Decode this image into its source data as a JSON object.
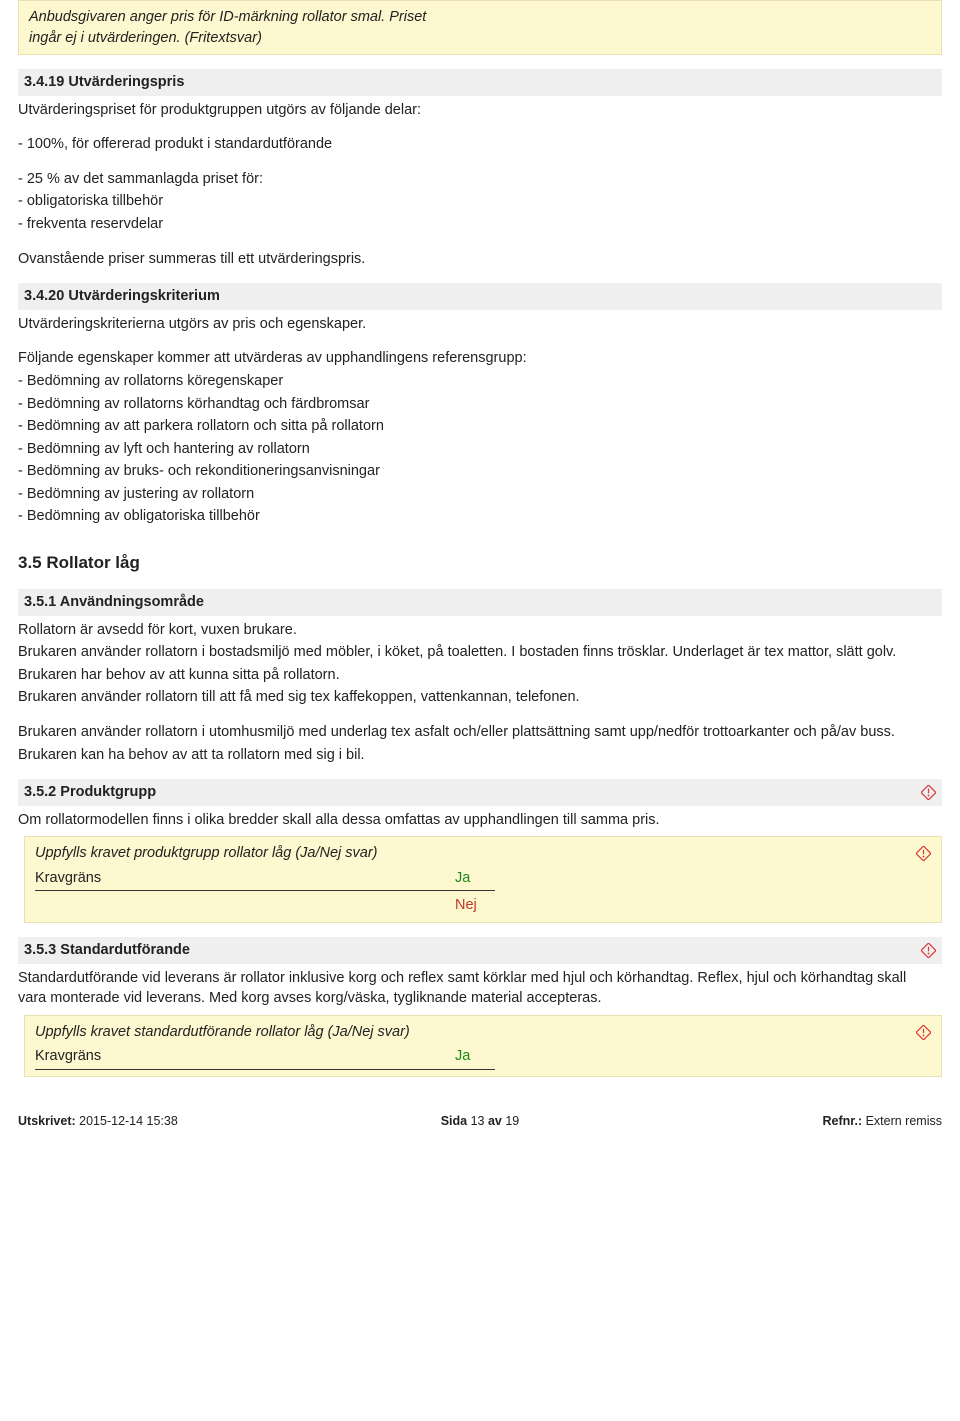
{
  "intro": {
    "line1": "Anbudsgivaren anger pris för ID-märkning rollator smal. Priset",
    "line2": "ingår ej i utvärderingen. (Fritextsvar)"
  },
  "s3419": {
    "title": "3.4.19 Utvärderingspris",
    "intro": "Utvärderingspriset för produktgruppen utgörs av följande delar:",
    "b1": "- 100%, för offererad produkt i standardutförande",
    "b2": "- 25 % av det sammanlagda priset för:",
    "b3": "- obligatoriska tillbehör",
    "b4": "- frekventa reservdelar",
    "outro": "Ovanstående priser summeras till ett utvärderingspris."
  },
  "s3420": {
    "title": "3.4.20 Utvärderingskriterium",
    "intro": "Utvärderingskriterierna utgörs av pris och egenskaper.",
    "list_intro": "Följande egenskaper kommer att utvärderas av upphandlingens referensgrupp:",
    "i1": "- Bedömning av rollatorns köregenskaper",
    "i2": "- Bedömning av rollatorns körhandtag och färdbromsar",
    "i3": "- Bedömning av att parkera rollatorn och sitta på rollatorn",
    "i4": "- Bedömning av lyft och hantering av rollatorn",
    "i5": "- Bedömning av bruks- och rekonditioneringsanvisningar",
    "i6": "- Bedömning av justering av rollatorn",
    "i7": "- Bedömning av obligatoriska tillbehör"
  },
  "s35": {
    "title": "3.5 Rollator låg"
  },
  "s351": {
    "title": "3.5.1 Användningsområde",
    "p1": "Rollatorn är avsedd för kort, vuxen brukare.",
    "p2": "Brukaren använder rollatorn i bostadsmiljö med möbler, i köket, på toaletten. I bostaden finns trösklar. Underlaget är tex mattor, slätt golv.",
    "p3": "Brukaren har behov av att kunna sitta på rollatorn.",
    "p4": "Brukaren använder rollatorn till att få med sig tex kaffekoppen, vattenkannan, telefonen.",
    "p5": "Brukaren använder rollatorn i utomhusmiljö med underlag tex asfalt och/eller plattsättning samt upp/nedför trottoarkanter och på/av buss.",
    "p6": "Brukaren kan ha behov av att ta rollatorn med sig i bil."
  },
  "s352": {
    "title": "3.5.2 Produktgrupp",
    "body": "Om rollatormodellen finns i olika bredder skall alla dessa omfattas av upphandlingen till samma pris.",
    "q": "Uppfylls kravet produktgrupp rollator låg (Ja/Nej svar)",
    "kravgrans": "Kravgräns",
    "yes": "Ja",
    "no": "Nej"
  },
  "s353": {
    "title": "3.5.3 Standardutförande",
    "body": "Standardutförande vid leverans är rollator inklusive korg och reflex samt körklar med hjul och körhandtag. Reflex, hjul och körhandtag skall vara monterade vid leverans. Med korg avses korg/väska, tygliknande material accepteras.",
    "q": "Uppfylls kravet standardutförande rollator låg (Ja/Nej svar)",
    "kravgrans": "Kravgräns",
    "yes": "Ja"
  },
  "footer": {
    "printed_label": "Utskrivet:",
    "printed_val": " 2015-12-14 15:38",
    "page_label": "Sida ",
    "page_cur": "13",
    "page_of": " av ",
    "page_total": "19",
    "ref_label": "Refnr.:",
    "ref_val": " Extern remiss"
  }
}
